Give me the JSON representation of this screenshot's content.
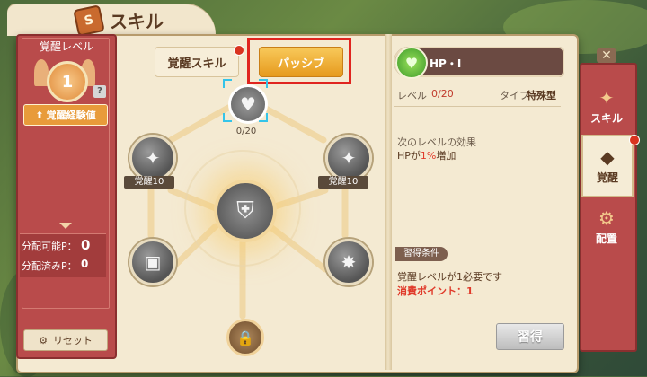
{
  "header": {
    "title": "スキル",
    "icon": "spell-book-icon"
  },
  "left_panel": {
    "level_label": "覚醒レベル",
    "level_value": "1",
    "help": "?",
    "exp_button": "覚醒経験値",
    "points": [
      {
        "label": "分配可能P：",
        "value": "0"
      },
      {
        "label": "分配済みP：",
        "value": "0"
      }
    ],
    "reset_button": "リセット"
  },
  "tabs": [
    {
      "label": "覚醒スキル",
      "active": false
    },
    {
      "label": "パッシブ",
      "active": true
    }
  ],
  "tree": {
    "hp_node_count": "0/20",
    "left_top_ribbon": "覚醒10",
    "right_top_ribbon": "覚醒10"
  },
  "detail": {
    "skill_name": "HP・Ⅰ",
    "level_label": "レベル",
    "level_value": "0/20",
    "type_label": "タイプ",
    "type_value": "特殊型",
    "next_effect_label": "次のレベルの効果",
    "effect_prefix": "HPが",
    "effect_value": "1%",
    "effect_suffix": "増加",
    "condition_tag": "習得条件",
    "condition_text": "覚醒レベルが1必要です",
    "cost_text": "消費ポイント：1",
    "learn_button": "習得"
  },
  "sidebar": {
    "items": [
      {
        "label": "スキル",
        "icon": "flame-icon"
      },
      {
        "label": "覚醒",
        "icon": "awaken-icon",
        "active": true
      },
      {
        "label": "配置",
        "icon": "gear-icon"
      }
    ]
  },
  "colors": {
    "accent_red": "#b94b4b",
    "tab_orange": "#e69a1e",
    "highlight": "#e0251f",
    "page": "#f4ead2"
  }
}
